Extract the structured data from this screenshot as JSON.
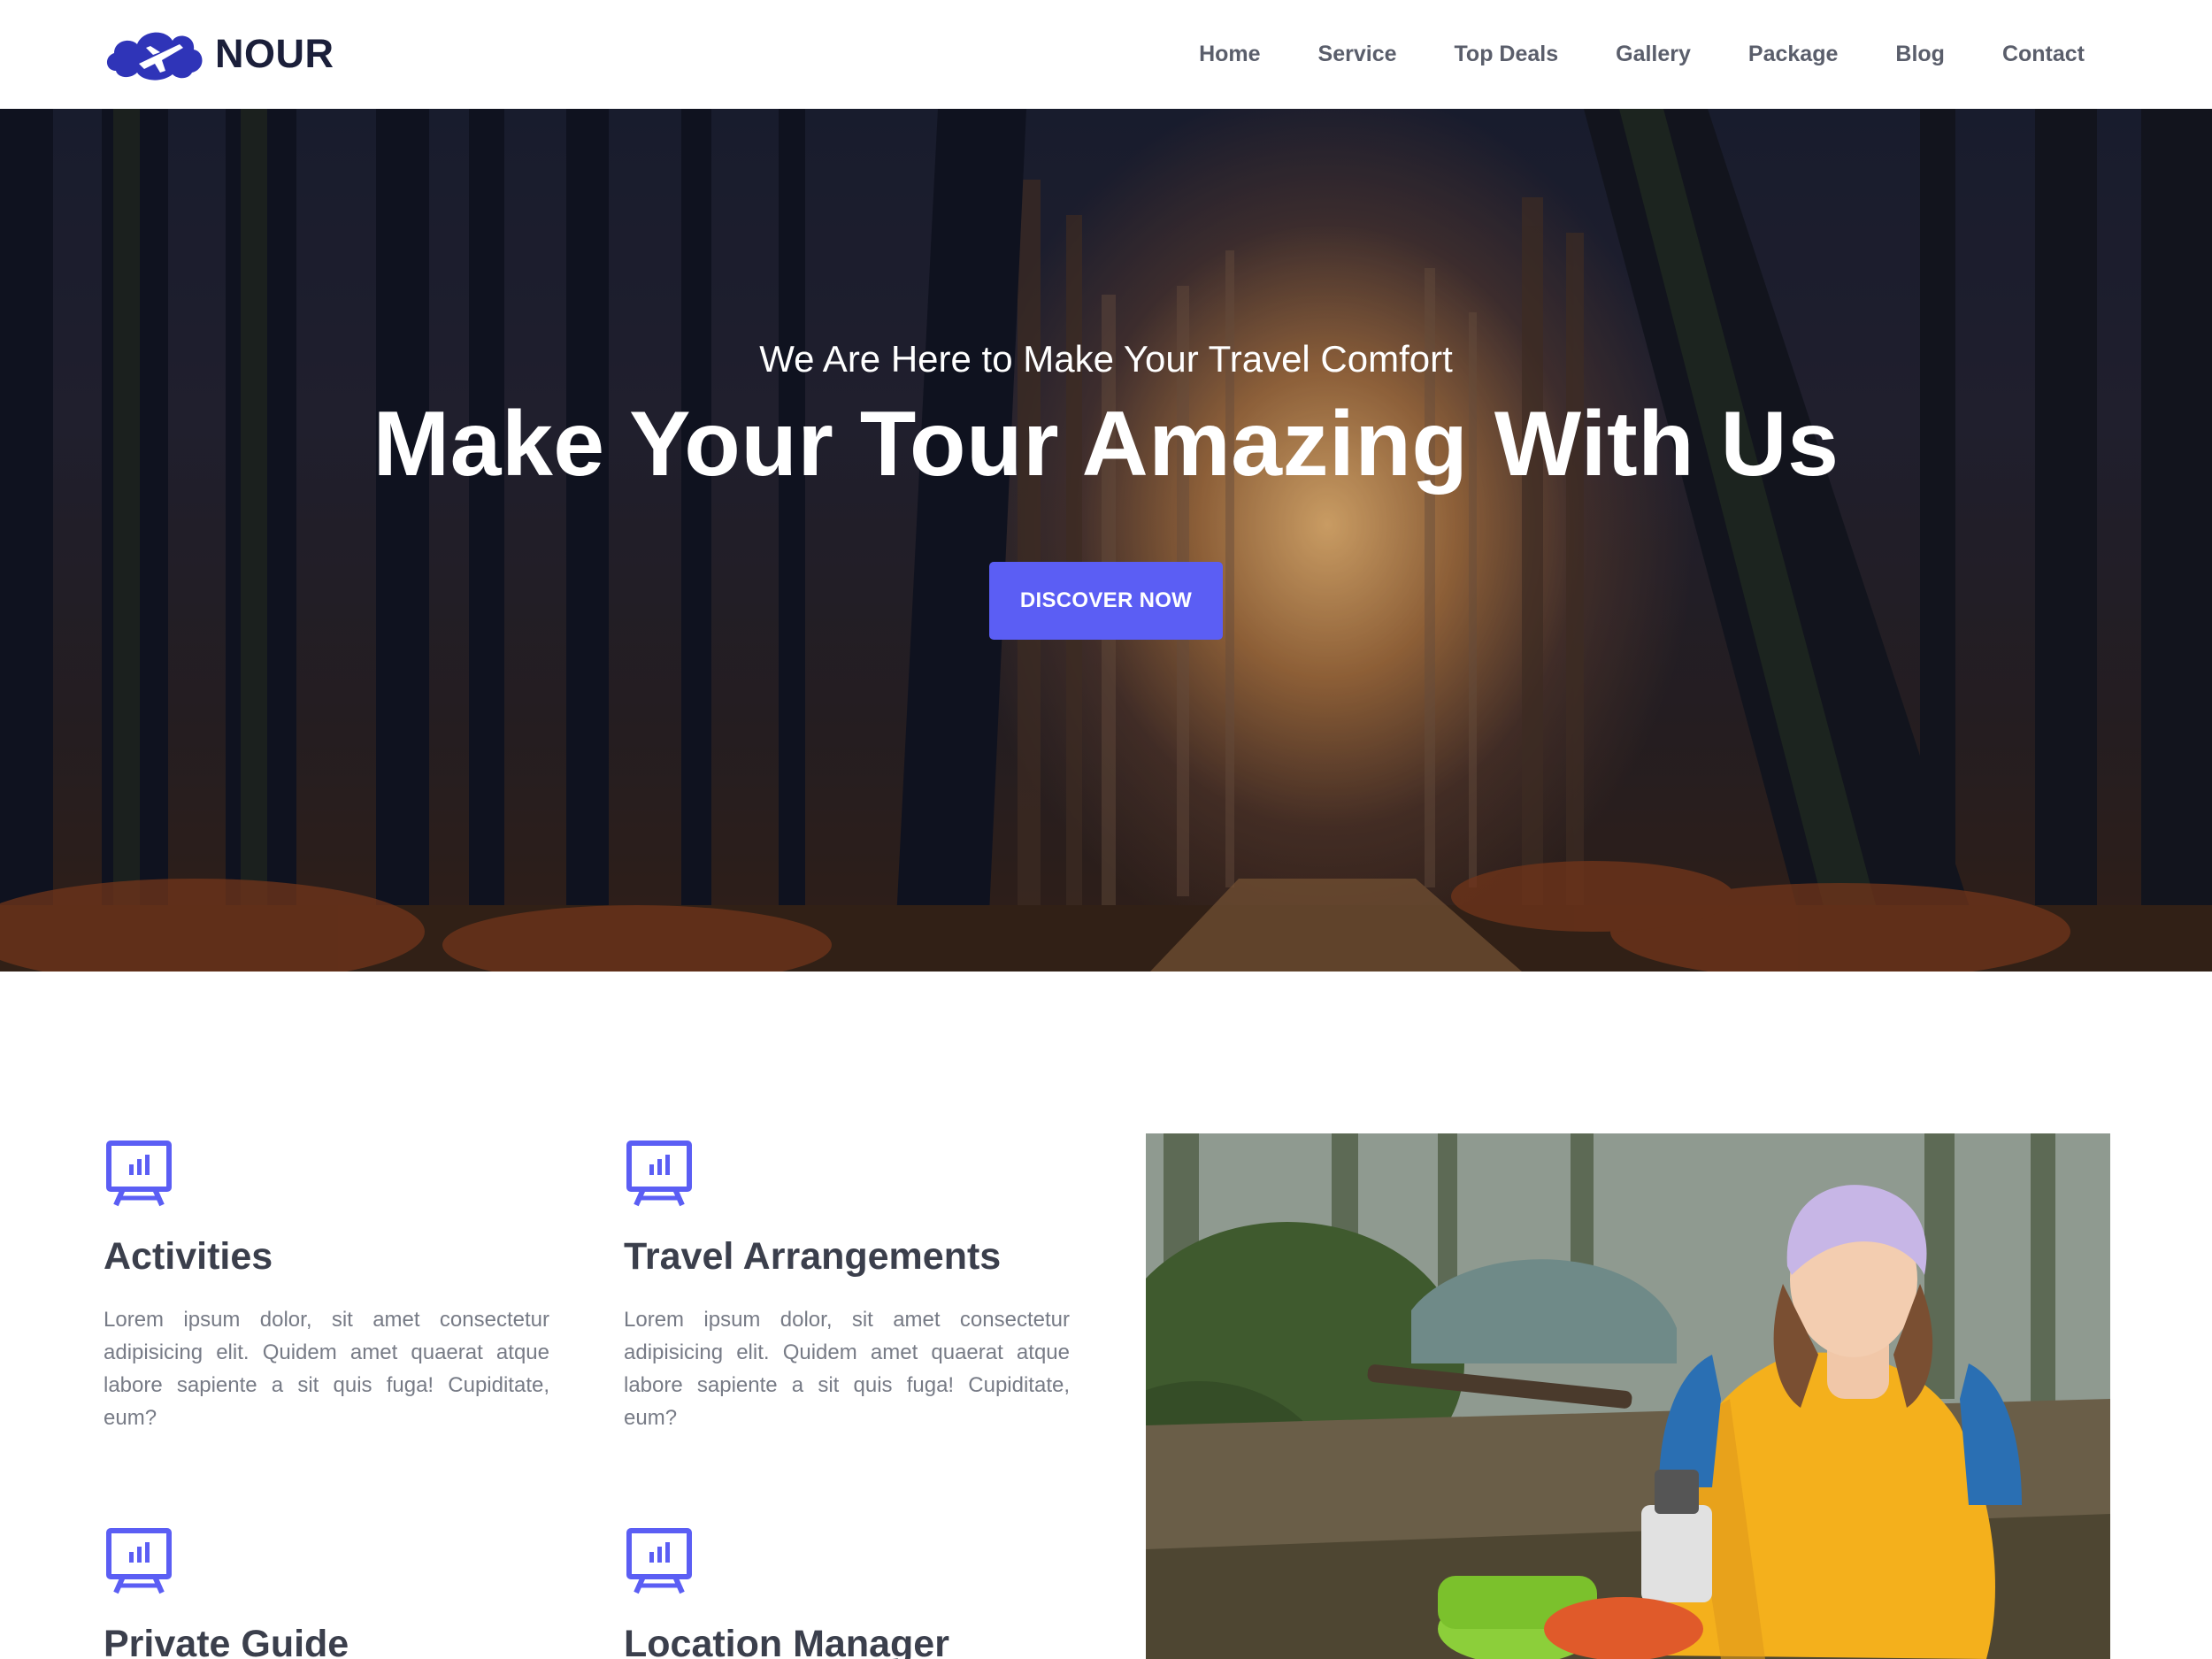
{
  "brand": {
    "name": "NOUR",
    "logo_icon": "cloud-plane-icon",
    "primary_color": "#3b3fc4",
    "accent_color": "#5b5ef4"
  },
  "nav": {
    "items": [
      "Home",
      "Service",
      "Top Deals",
      "Gallery",
      "Package",
      "Blog",
      "Contact"
    ]
  },
  "hero": {
    "subtitle": "We Are Here to Make Your Travel Comfort",
    "title": "Make Your Tour Amazing With Us",
    "button_label": "DISCOVER NOW",
    "background": "misty-forest-path-photo"
  },
  "services": [
    {
      "title": "Activities",
      "icon": "presentation-chart-icon",
      "text": "Lorem ipsum dolor, sit amet consectetur adipisicing elit. Quidem amet quaerat atque labore sapiente a sit quis fuga! Cupiditate, eum?"
    },
    {
      "title": "Travel Arrangements",
      "icon": "presentation-chart-icon",
      "text": "Lorem ipsum dolor, sit amet consectetur adipisicing elit. Quidem amet quaerat atque labore sapiente a sit quis fuga! Cupiditate, eum?"
    },
    {
      "title": "Private Guide",
      "icon": "presentation-chart-icon",
      "text": ""
    },
    {
      "title": "Location Manager",
      "icon": "presentation-chart-icon",
      "text": ""
    }
  ],
  "side_photo": {
    "subject": "hiker-woman-camping-photo"
  }
}
